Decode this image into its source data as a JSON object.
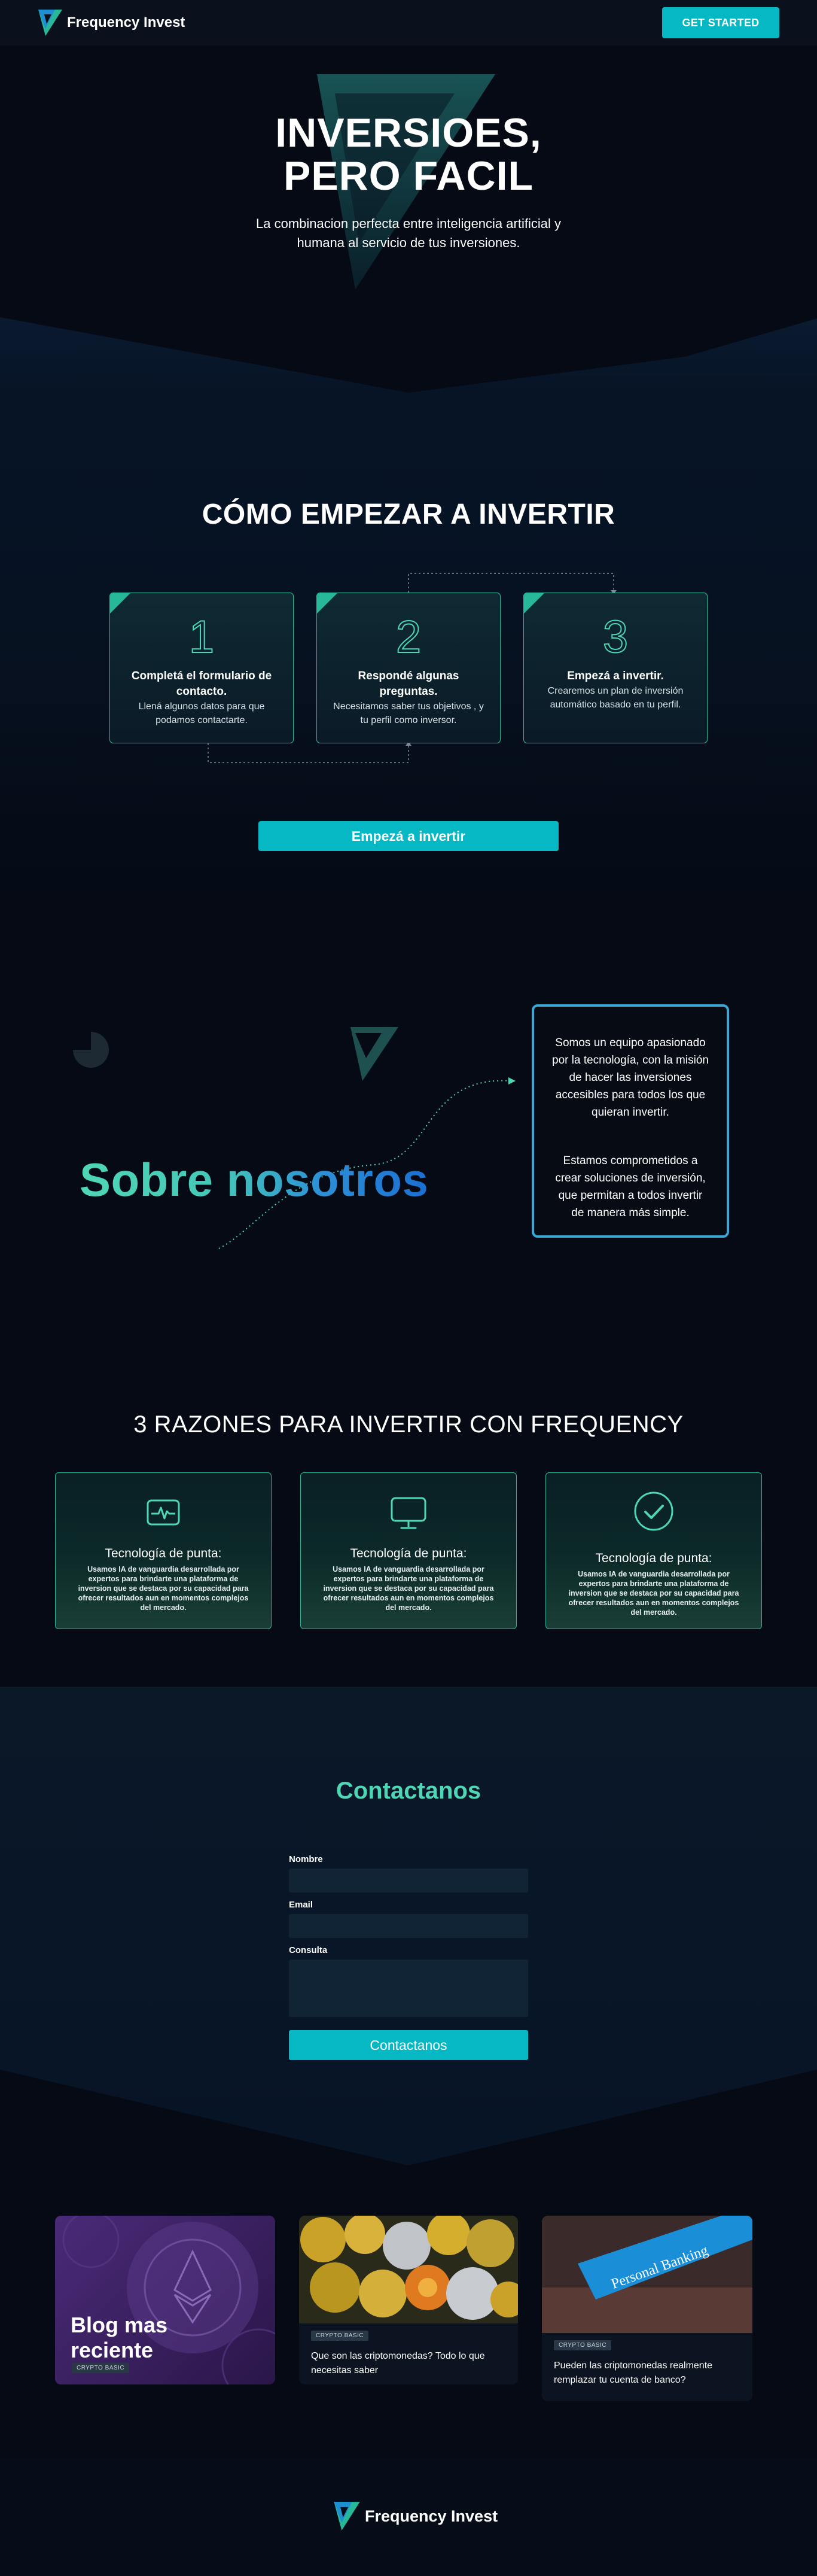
{
  "header": {
    "brand": "Frequency Invest",
    "cta_label": "GET STARTED"
  },
  "hero": {
    "title_line1": "INVERSIOES,",
    "title_line2": "PERO FACIL",
    "subtitle_line1": "La combinacion perfecta entre inteligencia artificial y",
    "subtitle_line2": "humana al servicio de tus inversiones."
  },
  "how": {
    "title": "CÓMO EMPEZAR A INVERTIR",
    "steps": [
      {
        "number": "1",
        "title": "Completá el formulario de contacto.",
        "text": "Llená algunos datos para que podamos contactarte."
      },
      {
        "number": "2",
        "title": "Respondé algunas preguntas.",
        "text": "Necesitamos saber tus objetivos , y tu perfil como inversor."
      },
      {
        "number": "3",
        "title": "Empezá a invertir.",
        "text": "Crearemos un plan de inversión automático basado en tu perfil."
      }
    ],
    "cta_label": "Empezá a invertir"
  },
  "about": {
    "title": "Sobre nosotros",
    "paragraph1": "Somos un equipo apasionado por la tecnología, con la misión de hacer las inversiones accesibles para todos los que quieran invertir.",
    "paragraph2": "Estamos comprometidos a crear soluciones de inversión, que permitan a todos invertir de manera más simple."
  },
  "reasons": {
    "title": "3 RAZONES PARA INVERTIR CON FREQUENCY",
    "items": [
      {
        "icon": "activity-icon",
        "title": "Tecnología de punta:",
        "text": "Usamos IA de vanguardia desarrollada por expertos para brindarte una plataforma de inversion que se destaca por su capacidad para ofrecer resultados aun en momentos complejos del mercado."
      },
      {
        "icon": "monitor-icon",
        "title": "Tecnología de punta:",
        "text": "Usamos IA de vanguardia desarrollada por expertos para brindarte una plataforma de inversion que se destaca por su capacidad para ofrecer resultados aun en momentos complejos del mercado."
      },
      {
        "icon": "check-circle-icon",
        "title": "Tecnología de punta:",
        "text": "Usamos IA de vanguardia desarrollada por expertos para brindarte una plataforma de inversion que se destaca por su capacidad para ofrecer resultados aun en momentos complejos del mercado."
      }
    ]
  },
  "contact": {
    "title": "Contactanos",
    "name_label": "Nombre",
    "email_label": "Email",
    "query_label": "Consulta",
    "submit_label": "Contactanos"
  },
  "blog": {
    "featured_title_line1": "Blog mas",
    "featured_title_line2": "reciente",
    "featured_tag": "CRYPTO BASIC",
    "posts": [
      {
        "tag": "CRYPTO BASIC",
        "title": "Que son las criptomonedas? Todo lo que necesitas saber"
      },
      {
        "tag": "CRYPTO BASIC",
        "title": "Pueden las criptomonedas realmente remplazar tu cuenta de banco?",
        "image_sign": "Personal Banking"
      }
    ]
  },
  "footer": {
    "brand": "Frequency Invest"
  },
  "colors": {
    "accent": "#05b8c4",
    "teal": "#27b89a",
    "mint": "#4fd6b5",
    "blue": "#3aa7d6",
    "background": "#050a14"
  }
}
